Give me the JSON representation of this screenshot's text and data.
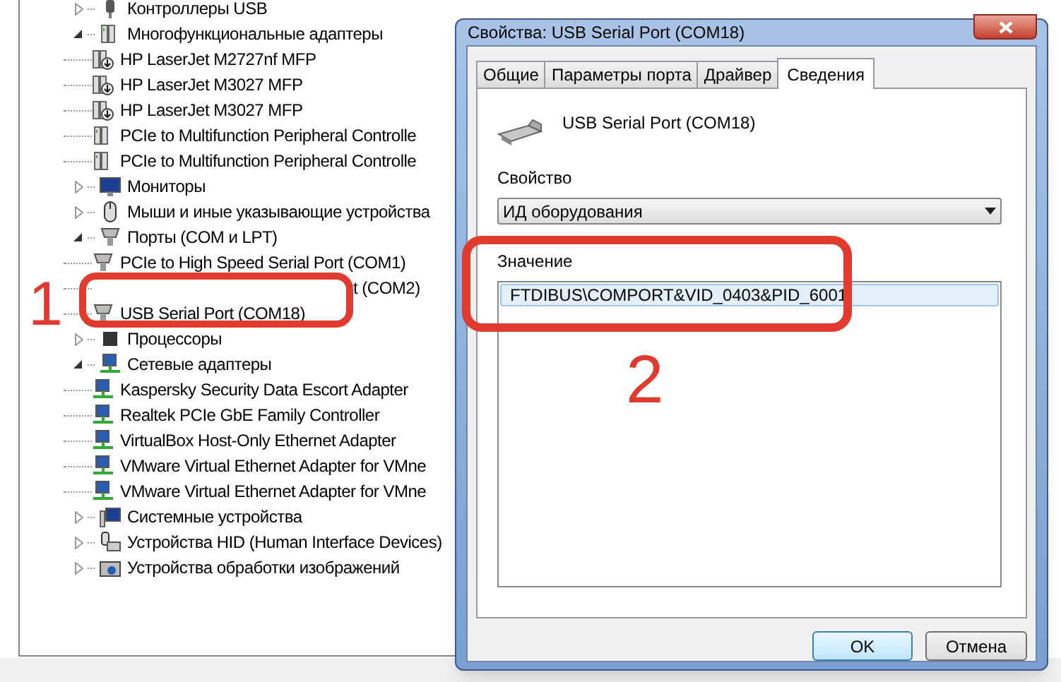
{
  "tree": [
    {
      "label": "Контроллеры USB",
      "kind": "usb",
      "expanded": false
    },
    {
      "label": "Многофункциональные адаптеры",
      "kind": "multifunction",
      "expanded": true,
      "children": [
        {
          "label": "HP LaserJet M2727nf MFP",
          "kind": "printer"
        },
        {
          "label": "HP LaserJet M3027 MFP",
          "kind": "printer"
        },
        {
          "label": "HP LaserJet M3027 MFP",
          "kind": "printer"
        },
        {
          "label": "PCIe to Multifunction Peripheral Controlle",
          "kind": "multifunction"
        },
        {
          "label": "PCIe to Multifunction Peripheral Controlle",
          "kind": "multifunction"
        }
      ]
    },
    {
      "label": "Мониторы",
      "kind": "monitor",
      "expanded": false
    },
    {
      "label": "Мыши и иные указывающие устройства",
      "kind": "mouse",
      "expanded": false
    },
    {
      "label": "Порты (COM и LPT)",
      "kind": "port",
      "expanded": true,
      "children": [
        {
          "label": "PCIe to High Speed Serial Port (COM1)",
          "kind": "port"
        },
        {
          "label": "t (COM2)",
          "obscured": true
        },
        {
          "label": "USB Serial Port (COM18)",
          "kind": "port"
        }
      ]
    },
    {
      "label": "Процессоры",
      "kind": "cpu",
      "expanded": false
    },
    {
      "label": "Сетевые адаптеры",
      "kind": "network",
      "expanded": true,
      "children": [
        {
          "label": "Kaspersky Security Data Escort Adapter",
          "kind": "network"
        },
        {
          "label": "Realtek PCIe GbE Family Controller",
          "kind": "network"
        },
        {
          "label": "VirtualBox Host-Only Ethernet Adapter",
          "kind": "network"
        },
        {
          "label": "VMware Virtual Ethernet Adapter for VMne",
          "kind": "network"
        },
        {
          "label": "VMware Virtual Ethernet Adapter for VMne",
          "kind": "network"
        }
      ]
    },
    {
      "label": "Системные устройства",
      "kind": "system",
      "expanded": false
    },
    {
      "label": "Устройства HID (Human Interface Devices)",
      "kind": "hid",
      "expanded": false
    },
    {
      "label": "Устройства обработки изображений",
      "kind": "imaging",
      "expanded": false
    }
  ],
  "dialog": {
    "title": "Свойства: USB Serial Port (COM18)",
    "tabs": [
      {
        "label": "Общие",
        "selected": false
      },
      {
        "label": "Параметры порта",
        "selected": false
      },
      {
        "label": "Драйвер",
        "selected": false
      },
      {
        "label": "Сведения",
        "selected": true
      }
    ],
    "device_name": "USB Serial Port (COM18)",
    "property_label": "Свойство",
    "property_value": "ИД оборудования",
    "value_label": "Значение",
    "values": [
      {
        "text": "FTDIBUS\\COMPORT&VID_0403&PID_6001",
        "selected": true
      }
    ],
    "buttons": [
      {
        "label": "OK",
        "default": true
      },
      {
        "label": "Отмена",
        "default": false
      }
    ]
  },
  "annotations": [
    {
      "label": "1"
    },
    {
      "label": "2"
    }
  ]
}
